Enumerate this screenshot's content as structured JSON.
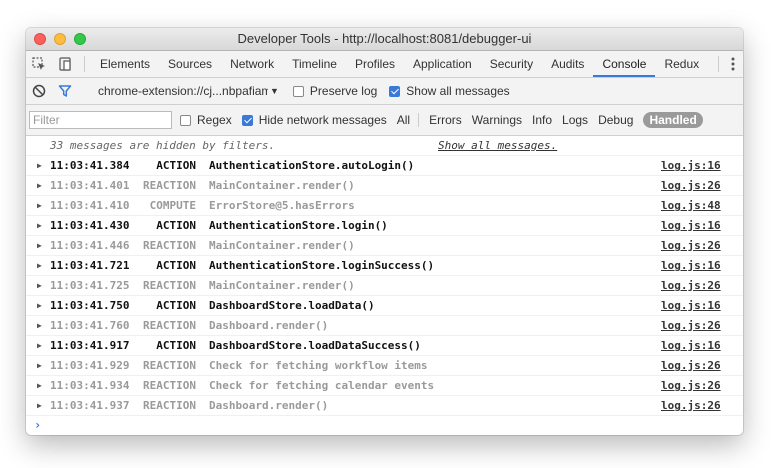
{
  "window": {
    "title": "Developer Tools - http://localhost:8081/debugger-ui"
  },
  "tabs": [
    {
      "label": "Elements"
    },
    {
      "label": "Sources"
    },
    {
      "label": "Network"
    },
    {
      "label": "Timeline"
    },
    {
      "label": "Profiles"
    },
    {
      "label": "Application"
    },
    {
      "label": "Security"
    },
    {
      "label": "Audits"
    },
    {
      "label": "Console",
      "active": true
    },
    {
      "label": "Redux"
    }
  ],
  "toolbar": {
    "context": "chrome-extension://cj...nbpafiam",
    "preserve_log": "Preserve log",
    "preserve_log_checked": false,
    "show_all": "Show all messages",
    "show_all_checked": true
  },
  "filterbar": {
    "placeholder": "Filter",
    "regex": "Regex",
    "hide_network": "Hide network messages",
    "levels": [
      "All",
      "Errors",
      "Warnings",
      "Info",
      "Logs",
      "Debug"
    ],
    "handled": "Handled"
  },
  "console": {
    "hidden_notice": "33 messages are hidden by filters.",
    "show_all_link": "Show all messages.",
    "rows": [
      {
        "time": "11:03:41.384",
        "kind": "ACTION",
        "msg": "AuthenticationStore.autoLogin()",
        "src": "log.js:16",
        "style": "bold"
      },
      {
        "time": "11:03:41.401",
        "kind": "REACTION",
        "msg": "MainContainer.render()",
        "src": "log.js:26",
        "style": "dim"
      },
      {
        "time": "11:03:41.410",
        "kind": "COMPUTE",
        "msg": "ErrorStore@5.hasErrors",
        "src": "log.js:48",
        "style": "dim"
      },
      {
        "time": "11:03:41.430",
        "kind": "ACTION",
        "msg": "AuthenticationStore.login()",
        "src": "log.js:16",
        "style": "bold"
      },
      {
        "time": "11:03:41.446",
        "kind": "REACTION",
        "msg": "MainContainer.render()",
        "src": "log.js:26",
        "style": "dim"
      },
      {
        "time": "11:03:41.721",
        "kind": "ACTION",
        "msg": "AuthenticationStore.loginSuccess()",
        "src": "log.js:16",
        "style": "bold"
      },
      {
        "time": "11:03:41.725",
        "kind": "REACTION",
        "msg": "MainContainer.render()",
        "src": "log.js:26",
        "style": "dim"
      },
      {
        "time": "11:03:41.750",
        "kind": "ACTION",
        "msg": "DashboardStore.loadData()",
        "src": "log.js:16",
        "style": "bold"
      },
      {
        "time": "11:03:41.760",
        "kind": "REACTION",
        "msg": "Dashboard.render()",
        "src": "log.js:26",
        "style": "dim"
      },
      {
        "time": "11:03:41.917",
        "kind": "ACTION",
        "msg": "DashboardStore.loadDataSuccess()",
        "src": "log.js:16",
        "style": "bold"
      },
      {
        "time": "11:03:41.929",
        "kind": "REACTION",
        "msg": "Check for fetching workflow items",
        "src": "log.js:26",
        "style": "dim"
      },
      {
        "time": "11:03:41.934",
        "kind": "REACTION",
        "msg": "Check for fetching calendar events",
        "src": "log.js:26",
        "style": "dim"
      },
      {
        "time": "11:03:41.937",
        "kind": "REACTION",
        "msg": "Dashboard.render()",
        "src": "log.js:26",
        "style": "dim"
      }
    ],
    "prompt": "›"
  }
}
